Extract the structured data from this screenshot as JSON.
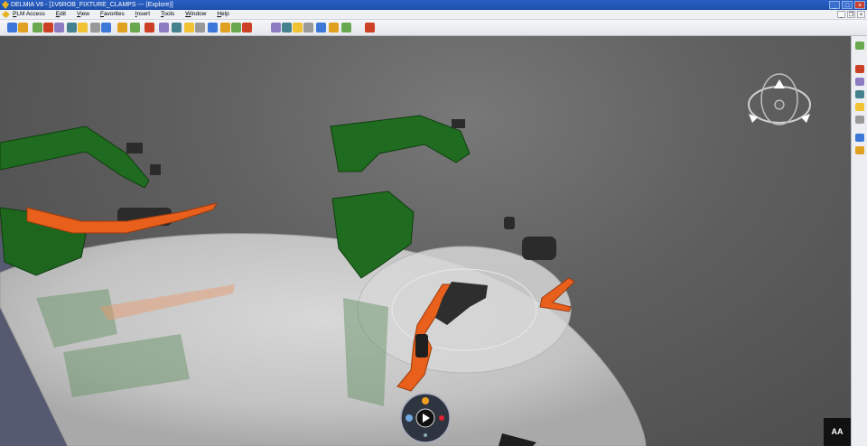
{
  "window": {
    "title": "DELMIA V6 - [1V6ROB_FIXTURE_CLAMPS --- (Explore)]",
    "minimize_label": "_",
    "maximize_label": "□",
    "close_label": "×"
  },
  "menu": {
    "items": [
      "PLM Access",
      "Edit",
      "View",
      "Favorites",
      "Insert",
      "Tools",
      "Window",
      "Help"
    ],
    "mdi_minimize": "_",
    "mdi_restore": "❐",
    "mdi_close": "×"
  },
  "toolbar": {
    "icons": [
      "new-icon",
      "open-icon",
      "cut-icon",
      "copy-icon",
      "paste-icon",
      "undo-icon",
      "redo-icon",
      "refresh-icon",
      "help-icon",
      "fit-all-icon",
      "pan-icon",
      "rotate-icon",
      "zoom-in-icon",
      "zoom-out-icon",
      "normal-view-icon",
      "render-style-icon",
      "hide-show-icon",
      "swap-icon",
      "measure-icon",
      "search-icon",
      "shading-icon",
      "material-icon",
      "analysis-icon",
      "robot-icon",
      "simulation-icon",
      "teach-icon",
      "layout-icon",
      "compass-icon"
    ]
  },
  "rightbar": {
    "icons": [
      "select-icon",
      "move-icon",
      "snap-icon",
      "align-icon",
      "layout-icon",
      "catalog-icon",
      "device-icon",
      "path-icon"
    ]
  },
  "viewport": {
    "colors": {
      "fixture_green": "#1f6b1f",
      "clamp_orange": "#e8601c",
      "metal_dark": "#2b2b2b"
    }
  },
  "robot_bar": {
    "label": "AA"
  }
}
